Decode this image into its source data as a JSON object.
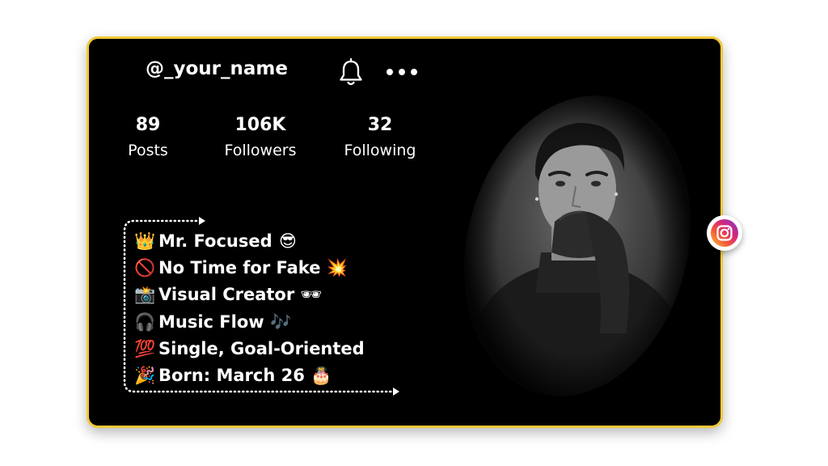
{
  "profile": {
    "username": "@_your_name",
    "stats": [
      {
        "value": "89",
        "label": "Posts"
      },
      {
        "value": "106K",
        "label": "Followers"
      },
      {
        "value": "32",
        "label": "Following"
      }
    ]
  },
  "bio": [
    {
      "icon": "crown-icon",
      "emoji": "👑",
      "text": "Mr. Focused",
      "end_emoji": "😎"
    },
    {
      "icon": "no-entry-icon",
      "emoji": "🚫",
      "text": "No Time for Fake",
      "end_emoji": "💥"
    },
    {
      "icon": "camera-flash-icon",
      "emoji": "📸",
      "text": "Visual Creator",
      "end_emoji": "🕶"
    },
    {
      "icon": "headphone-icon",
      "emoji": "🎧",
      "text": "Music Flow",
      "end_emoji": "🎶"
    },
    {
      "icon": "hundred-points-icon",
      "emoji": "💯",
      "text": "Single, Goal-Oriented",
      "end_emoji": ""
    },
    {
      "icon": "party-popper-icon",
      "emoji": "🎉",
      "text": "Born: March 26",
      "end_emoji": "🎂"
    }
  ],
  "colors": {
    "card_border": "#f0c93a",
    "card_background": "#000000",
    "text": "#ffffff"
  },
  "icons": {
    "notification": "bell-icon",
    "more": "more-dots-icon",
    "instagram": "instagram-icon"
  }
}
